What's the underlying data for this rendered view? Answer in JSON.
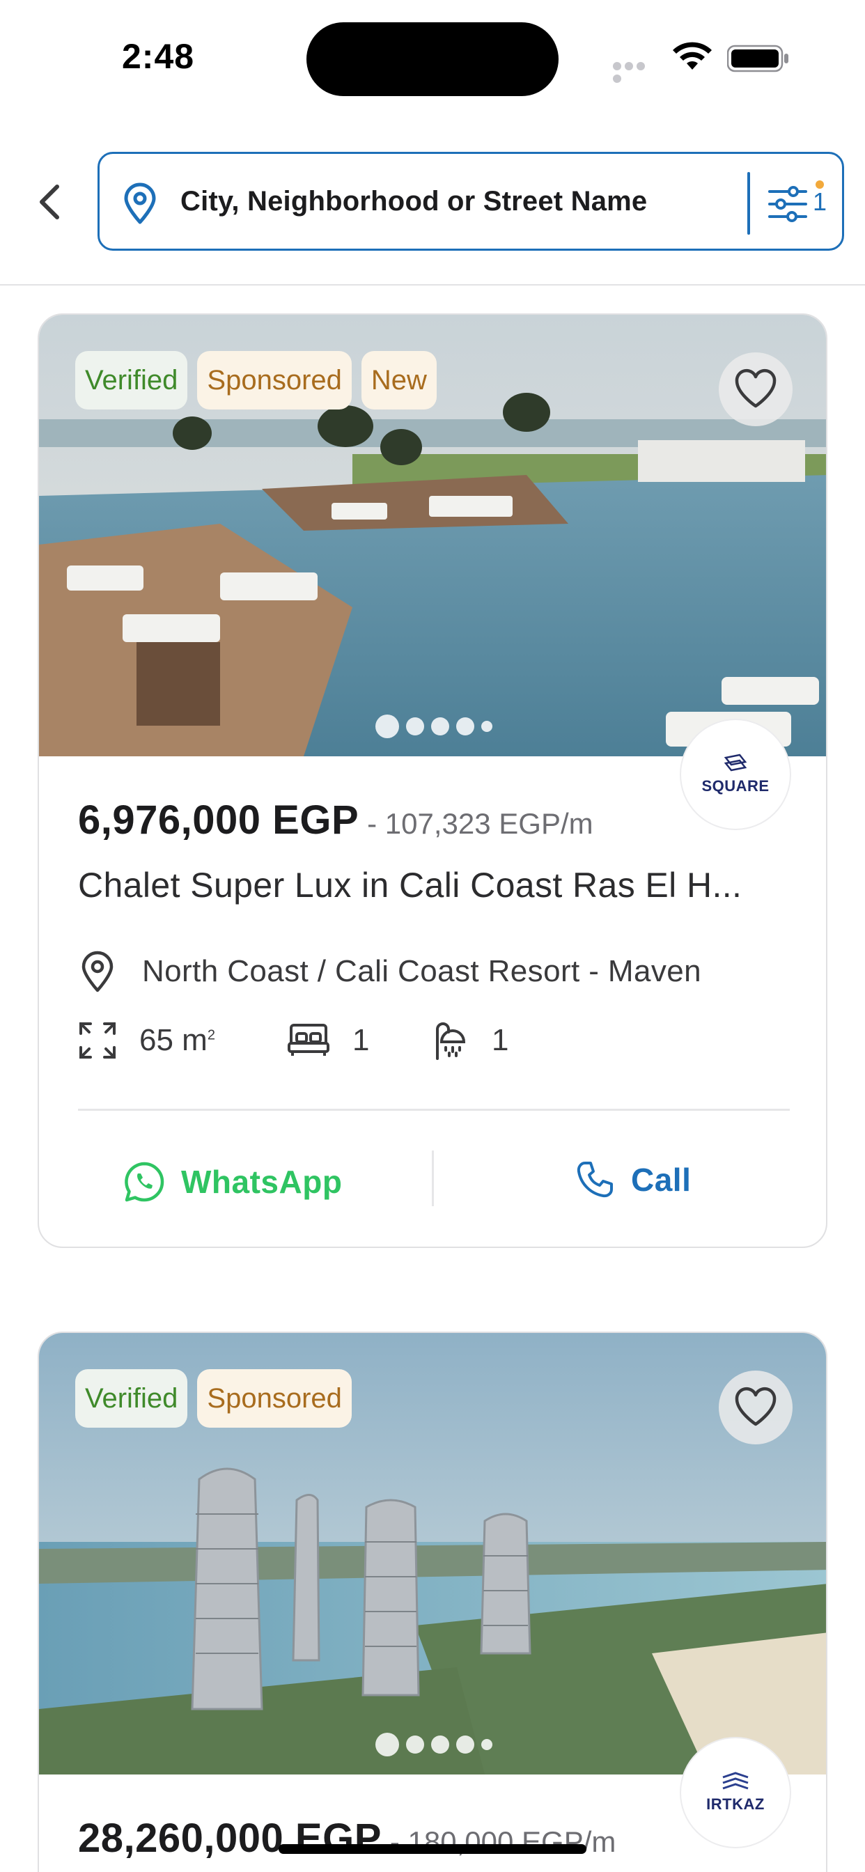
{
  "status_bar": {
    "time": "2:48"
  },
  "header": {
    "search_placeholder": "City, Neighborhood or Street Name",
    "filter_count": "1"
  },
  "listings": [
    {
      "badges": [
        "Verified",
        "Sponsored",
        "New"
      ],
      "price": "6,976,000 EGP",
      "price_per": "- 107,323 EGP/m",
      "title": "Chalet Super Lux in Cali Coast Ras El H...",
      "location": "North Coast / Cali Coast Resort - Maven",
      "area": "65 m",
      "area_sup": "2",
      "beds": "1",
      "baths": "1",
      "agency_logo_text": "SQUARE",
      "image_pager": {
        "count": 5,
        "active": 1
      },
      "actions": {
        "whatsapp": "WhatsApp",
        "call": "Call"
      }
    },
    {
      "badges": [
        "Verified",
        "Sponsored"
      ],
      "price": "28,260,000 EGP",
      "price_per": "- 180,000 EGP/m",
      "agency_logo_text": "IRTKAZ",
      "image_pager": {
        "count": 5,
        "active": 1
      }
    }
  ],
  "colors": {
    "accent_blue": "#1d6fb8",
    "whatsapp_green": "#2fc462",
    "verified_green": "#3f8a2a",
    "sponsored_brown": "#a86c1e"
  },
  "icons": [
    "chevron-left-icon",
    "location-pin-icon",
    "filter-sliders-icon",
    "heart-icon",
    "expand-area-icon",
    "bed-icon",
    "shower-icon",
    "whatsapp-icon",
    "phone-icon"
  ]
}
